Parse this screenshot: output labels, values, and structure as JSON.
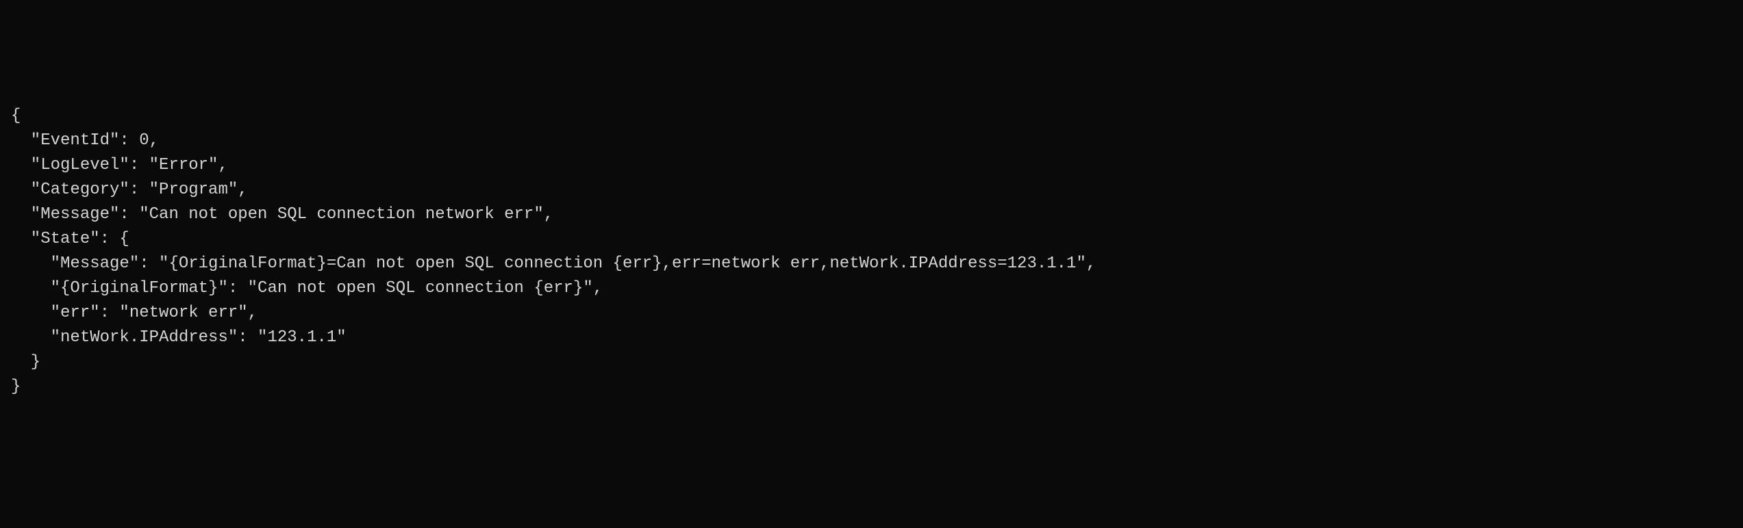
{
  "json_content": {
    "line1": "{",
    "line2": "  \"EventId\": 0,",
    "line3": "  \"LogLevel\": \"Error\",",
    "line4": "  \"Category\": \"Program\",",
    "line5": "  \"Message\": \"Can not open SQL connection network err\",",
    "line6": "  \"State\": {",
    "line7": "    \"Message\": \"{OriginalFormat}=Can not open SQL connection {err},err=network err,netWork.IPAddress=123.1.1\",",
    "line8": "    \"{OriginalFormat}\": \"Can not open SQL connection {err}\",",
    "line9": "    \"err\": \"network err\",",
    "line10": "    \"netWork.IPAddress\": \"123.1.1\"",
    "line11": "  }",
    "line12": "}"
  }
}
